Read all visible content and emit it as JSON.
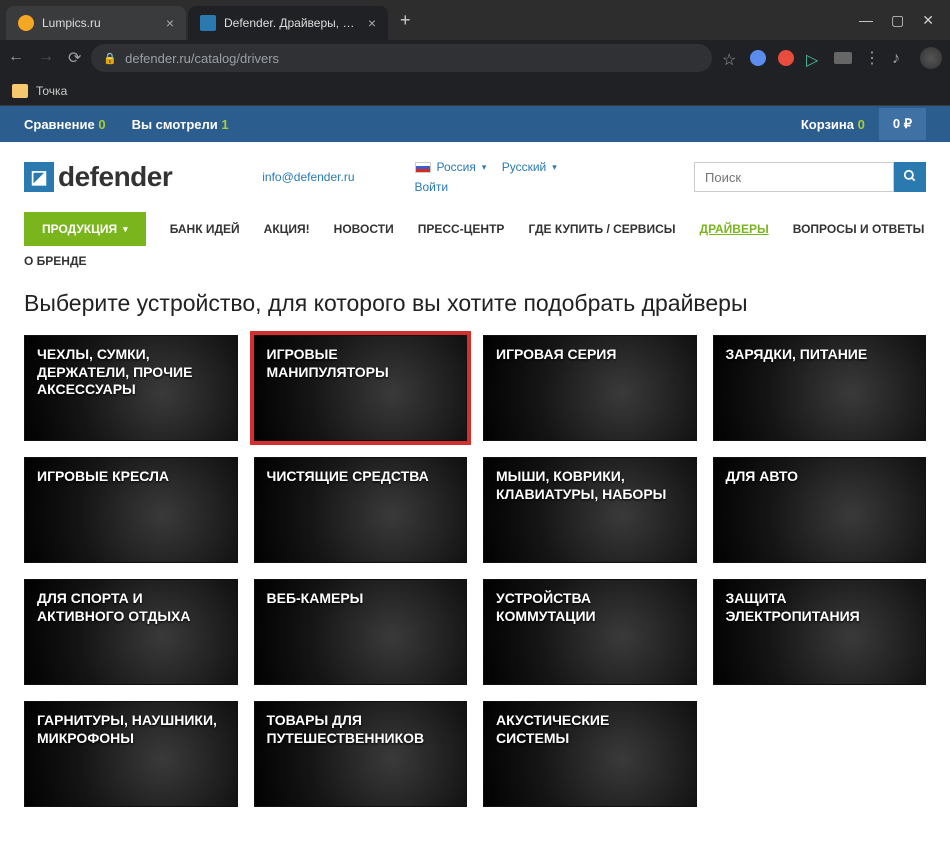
{
  "tabs": [
    {
      "title": "Lumpics.ru"
    },
    {
      "title": "Defender. Драйверы, инструк..."
    }
  ],
  "url": "defender.ru/catalog/drivers",
  "bookmark": "Точка",
  "topbar": {
    "compare_label": "Сравнение",
    "compare_count": "0",
    "viewed_label": "Вы смотрели",
    "viewed_count": "1",
    "cart_label": "Корзина",
    "cart_count": "0",
    "price": "0 ₽"
  },
  "header": {
    "logo_text": "defender",
    "email": "info@defender.ru",
    "login": "Войти",
    "country": "Россия",
    "language": "Русский"
  },
  "search": {
    "placeholder": "Поиск"
  },
  "nav": {
    "products": "ПРОДУКЦИЯ",
    "items": [
      "БАНК ИДЕЙ",
      "АКЦИЯ!",
      "НОВОСТИ",
      "ПРЕСС-ЦЕНТР",
      "ГДЕ КУПИТЬ / СЕРВИСЫ",
      "ДРАЙВЕРЫ",
      "ВОПРОСЫ И ОТВЕТЫ"
    ],
    "about": "О БРЕНДЕ"
  },
  "content": {
    "heading": "Выберите устройство, для которого вы хотите подобрать драйверы",
    "cards": [
      "ЧЕХЛЫ, СУМКИ, ДЕРЖАТЕЛИ, ПРОЧИЕ АКСЕССУАРЫ",
      "ИГРОВЫЕ МАНИПУЛЯТОРЫ",
      "ИГРОВАЯ СЕРИЯ",
      "ЗАРЯДКИ, ПИТАНИЕ",
      "ИГРОВЫЕ КРЕСЛА",
      "ЧИСТЯЩИЕ СРЕДСТВА",
      "МЫШИ, КОВРИКИ, КЛАВИАТУРЫ, НАБОРЫ",
      "ДЛЯ АВТО",
      "ДЛЯ СПОРТА И АКТИВНОГО ОТДЫХА",
      "ВЕБ-КАМЕРЫ",
      "УСТРОЙСТВА КОММУТАЦИИ",
      "ЗАЩИТА ЭЛЕКТРОПИТАНИЯ",
      "ГАРНИТУРЫ, НАУШНИКИ, МИКРОФОНЫ",
      "ТОВАРЫ ДЛЯ ПУТЕШЕСТВЕННИКОВ",
      "АКУСТИЧЕСКИЕ СИСТЕМЫ"
    ]
  }
}
